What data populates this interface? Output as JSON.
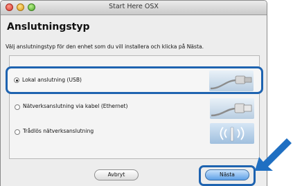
{
  "window": {
    "title": "Start Here OSX"
  },
  "header": {
    "heading": "Anslutningstyp",
    "subtitle": "Välj anslutningstyp för den enhet som du vill installera och klicka på Nästa."
  },
  "options": [
    {
      "label": "Lokal anslutning (USB)",
      "selected": true,
      "icon": "usb-cable-icon"
    },
    {
      "label": "Nätverksanslutning via kabel (Ethernet)",
      "selected": false,
      "icon": "ethernet-cable-icon"
    },
    {
      "label": "Trådlös nätverksanslutning",
      "selected": false,
      "icon": "wireless-icon"
    }
  ],
  "buttons": {
    "cancel": "Avbryt",
    "next": "Nästa"
  },
  "colors": {
    "highlight": "#1e63b0",
    "arrow": "#1f6fc2"
  }
}
